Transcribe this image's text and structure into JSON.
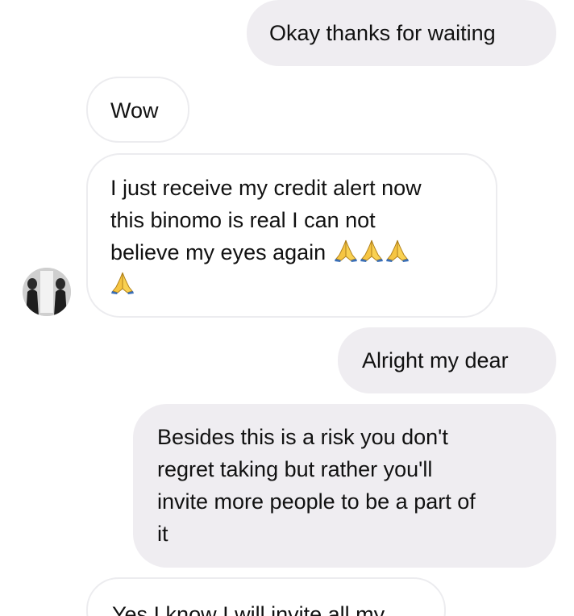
{
  "messages": [
    {
      "id": "m1",
      "side": "outgoing",
      "text": "Okay thanks for waiting"
    },
    {
      "id": "m2",
      "side": "incoming",
      "text": "Wow"
    },
    {
      "id": "m3",
      "side": "incoming",
      "text": "I just receive my credit alert now\nthis binomo is real I can not\nbelieve my eyes again",
      "emoji": "🙏🙏🙏🙏"
    },
    {
      "id": "m4",
      "side": "outgoing",
      "text": "Alright my dear"
    },
    {
      "id": "m5",
      "side": "outgoing",
      "text": "Besides this is a risk you don't\nregret taking but rather you'll\ninvite more people to be a part of\nit"
    },
    {
      "id": "m6",
      "side": "incoming",
      "text": "Yes I know I will invite all my"
    }
  ],
  "avatar": {
    "icon": "contact-avatar"
  },
  "icons": {
    "pray": "folded-hands-emoji"
  },
  "colors": {
    "outgoing_bubble": "#efedf1",
    "incoming_border": "#ececef",
    "text": "#111111",
    "background": "#ffffff"
  }
}
